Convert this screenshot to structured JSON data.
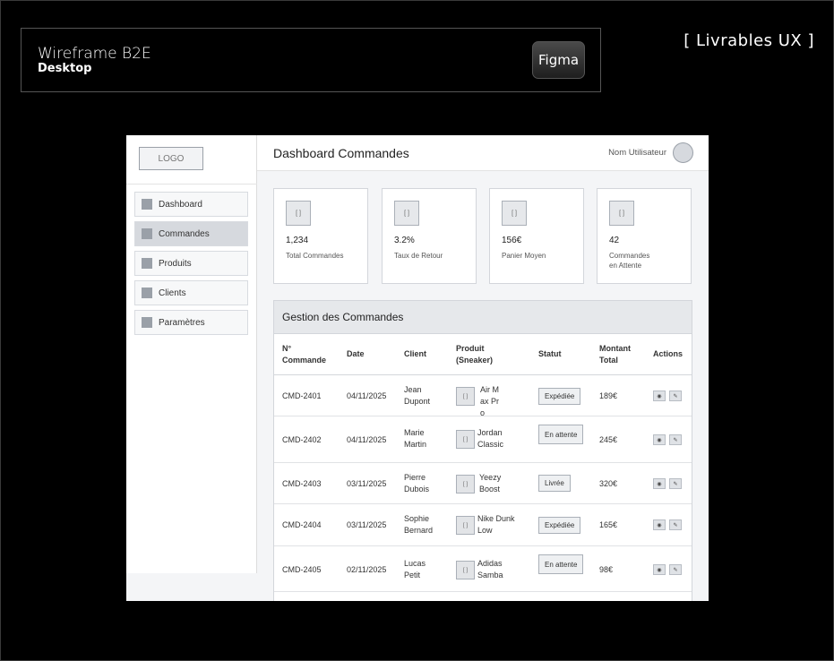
{
  "header": {
    "title": "Wireframe B2E",
    "subtitle": "Desktop",
    "tool_badge": "Figma",
    "deliverables": "[ Livrables UX ]"
  },
  "sidebar": {
    "logo": "LOGO",
    "items": [
      {
        "label": "Dashboard"
      },
      {
        "label": "Commandes"
      },
      {
        "label": "Produits"
      },
      {
        "label": "Clients"
      },
      {
        "label": "Paramètres"
      }
    ],
    "active": "Commandes"
  },
  "topbar": {
    "title": "Dashboard Commandes",
    "user": "Nom Utilisateur"
  },
  "kpis": [
    {
      "icon": "[ ]",
      "value": "1,234",
      "label": "Total Commandes"
    },
    {
      "icon": "[ ]",
      "value": "3.2%",
      "label": "Taux de Retour"
    },
    {
      "icon": "[ ]",
      "value": "156€",
      "label": "Panier Moyen"
    },
    {
      "icon": "[ ]",
      "value": "42",
      "label": "Commandes en Attente"
    }
  ],
  "orders": {
    "title": "Gestion des Commandes",
    "columns": [
      "N° Commande",
      "Date",
      "Client",
      "Produit (Sneaker)",
      "Statut",
      "Montant Total",
      "Actions"
    ],
    "rows": [
      {
        "id": "CMD-2401",
        "date": "04/11/2025",
        "client": "Jean Dupont",
        "product": "Air Max Pro",
        "thumb": "[ ]",
        "status": "Expédiée",
        "amount": "189€"
      },
      {
        "id": "CMD-2402",
        "date": "04/11/2025",
        "client": "Marie Martin",
        "product": "Jordan Classic",
        "thumb": "[ ]",
        "status": "En attente",
        "amount": "245€"
      },
      {
        "id": "CMD-2403",
        "date": "03/11/2025",
        "client": "Pierre Dubois",
        "product": "Yeezy Boost",
        "thumb": "[ ]",
        "status": "Livrée",
        "amount": "320€"
      },
      {
        "id": "CMD-2404",
        "date": "03/11/2025",
        "client": "Sophie Bernard",
        "product": "Nike Dunk Low",
        "thumb": "[ ]",
        "status": "Expédiée",
        "amount": "165€"
      },
      {
        "id": "CMD-2405",
        "date": "02/11/2025",
        "client": "Lucas Petit",
        "product": "Adidas Samba",
        "thumb": "[ ]",
        "status": "En attente",
        "amount": "98€"
      }
    ],
    "action_icons": [
      "eye-icon",
      "edit-icon"
    ]
  }
}
